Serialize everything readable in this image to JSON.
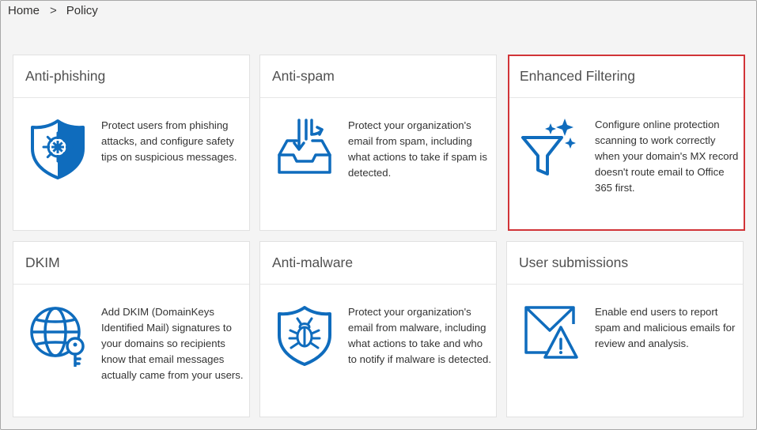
{
  "breadcrumb": {
    "home": "Home",
    "separator": ">",
    "current": "Policy"
  },
  "colors": {
    "icon_blue": "#0f6cbd",
    "highlight_border": "#d13438"
  },
  "cards": [
    {
      "title": "Anti-phishing",
      "icon": "shield-ship-wheel-icon",
      "description": "Protect users from phishing attacks, and configure safety tips on suspicious messages."
    },
    {
      "title": "Anti-spam",
      "icon": "inbox-filter-icon",
      "description": "Protect your organization's email from spam, including what actions to take if spam is detected."
    },
    {
      "title": "Enhanced Filtering",
      "icon": "funnel-sparkle-icon",
      "description": "Configure online protection scanning to work correctly when your domain's MX record doesn't route email to Office 365 first.",
      "highlighted": true
    },
    {
      "title": "DKIM",
      "icon": "globe-key-icon",
      "description": "Add DKIM (DomainKeys Identified Mail) signatures to your domains so recipients know that email messages actually came from your users."
    },
    {
      "title": "Anti-malware",
      "icon": "shield-bug-icon",
      "description": "Protect your organization's email from malware, including what actions to take and who to notify if malware is detected."
    },
    {
      "title": "User submissions",
      "icon": "envelope-warning-icon",
      "description": "Enable end users to report spam and malicious emails for review and analysis."
    }
  ]
}
